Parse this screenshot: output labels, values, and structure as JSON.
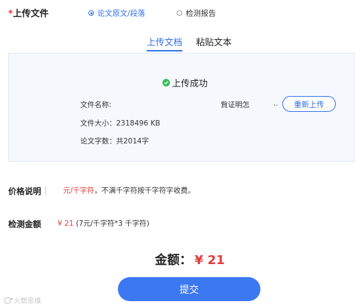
{
  "upload": {
    "required_mark": "*",
    "label": "上传文件",
    "options": [
      {
        "label": "论文原文/段落",
        "checked": true
      },
      {
        "label": "检测报告",
        "checked": false
      }
    ]
  },
  "tabs": [
    {
      "label": "上传文档",
      "active": true
    },
    {
      "label": "粘贴文本",
      "active": false
    }
  ],
  "panel": {
    "status": "上传成功",
    "file_name_label": "文件名称:",
    "file_name_value": "貲证明怎",
    "file_name_ellipsis": "..",
    "file_size": "文件大小：2318496 KB",
    "word_count": "论文字数：共2014字",
    "reupload_label": "重新上传"
  },
  "price": {
    "label": "价格说明",
    "unit_red": "元/千字符",
    "rule": "，不满千字符按千字符字收费。"
  },
  "detect": {
    "label": "检测金额",
    "amount_red": "¥ 21",
    "detail": " (7元/千字符*3 千字符)"
  },
  "total": {
    "label": "金额：",
    "value": "¥ 21"
  },
  "submit_label": "提交",
  "watermark": "火数思维",
  "colors": {
    "accent": "#2f6fe8",
    "price": "#e23b3b",
    "success": "#3dbd5c",
    "button": "#3c78f0"
  }
}
